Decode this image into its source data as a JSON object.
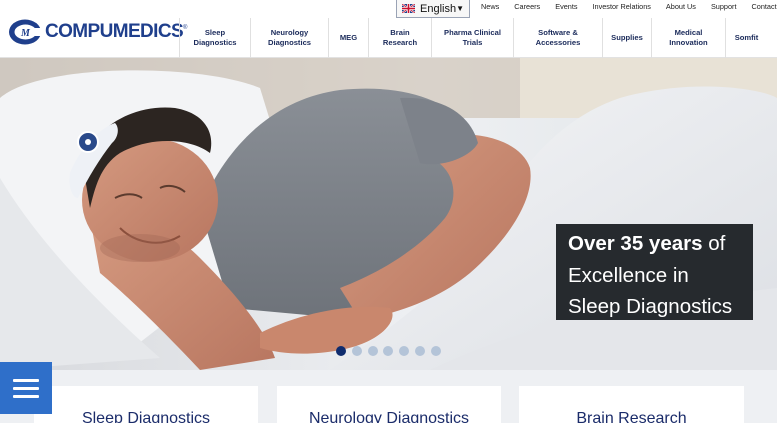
{
  "brand": {
    "name": "COMPUMEDICS",
    "registered": "®",
    "colors": {
      "primary": "#1f3f8c",
      "accent": "#2f6fc9",
      "overlay": "#262a2e"
    }
  },
  "language": {
    "selected": "English"
  },
  "utility_links": [
    "News",
    "Careers",
    "Events",
    "Investor Relations",
    "About Us",
    "Support",
    "Contact"
  ],
  "nav": [
    {
      "line1": "Sleep",
      "line2": "Diagnostics"
    },
    {
      "line1": "Neurology",
      "line2": "Diagnostics"
    },
    {
      "line1": "MEG",
      "line2": ""
    },
    {
      "line1": "Brain",
      "line2": "Research"
    },
    {
      "line1": "Pharma Clinical",
      "line2": "Trials"
    },
    {
      "line1": "Software &",
      "line2": "Accessories"
    },
    {
      "line1": "Supplies",
      "line2": ""
    },
    {
      "line1": "Medical",
      "line2": "Innovation"
    },
    {
      "line1": "Somfit",
      "line2": ""
    }
  ],
  "hero": {
    "line1_bold": "Over 35 years",
    "line1_rest": " of",
    "line2": "Excellence in",
    "line3": "Sleep Diagnostics",
    "slide_count": 7,
    "active_slide": 1
  },
  "cards": [
    {
      "title": "Sleep Diagnostics"
    },
    {
      "title": "Neurology Diagnostics"
    },
    {
      "title": "Brain Research"
    }
  ]
}
